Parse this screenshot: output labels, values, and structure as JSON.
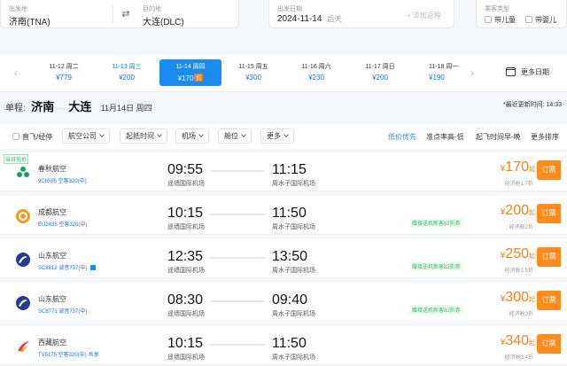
{
  "search": {
    "from_label": "出发地",
    "from_value": "济南(TNA)",
    "to_label": "目的地",
    "to_value": "大连(DLC)",
    "date_label": "出发日期",
    "date_value": "2024-11-14",
    "date_week": "后天",
    "add_return": "+ 添加返程",
    "pax_label": "乘客类型",
    "child": "带儿童",
    "infant": "带婴儿"
  },
  "date_strip": {
    "more": "更多日期",
    "low_tag": "低",
    "days": [
      {
        "date": "11-12 周二",
        "price": "¥779"
      },
      {
        "date": "11-13 周三",
        "price": "¥200"
      },
      {
        "date": "11-14 周四",
        "price": "¥170"
      },
      {
        "date": "11-15 周五",
        "price": "¥300"
      },
      {
        "date": "11-16 周六",
        "price": "¥230"
      },
      {
        "date": "11-17 周日",
        "price": "¥200"
      },
      {
        "date": "11-18 周一",
        "price": "¥190"
      }
    ]
  },
  "route": {
    "label": "单程:",
    "from": "济南",
    "to": "大连",
    "date": "11月14日 周四",
    "updated": "*最近更新时间: 14:33"
  },
  "filters": {
    "direct": "直飞/经停",
    "buttons": [
      "航空公司",
      "起抵时间",
      "机场",
      "舱位",
      "更多"
    ],
    "sorts": [
      "低价优先",
      "准点率高-低",
      "起飞时间早-晚",
      "更多排序"
    ]
  },
  "lowest_tag": "当日低价",
  "flights": [
    {
      "airline": "春秋航空",
      "no": "9C6595 空客320(中)",
      "dep_time": "09:55",
      "dep_airport": "遥墙国际机场",
      "arr_time": "11:15",
      "arr_airport": "周水子国际机场",
      "promo": "",
      "price": "170",
      "discount": "经济舱1.7折",
      "book": "订票",
      "color": "#19a05a"
    },
    {
      "airline": "成都航空",
      "no": "EU2435 空客320(中)",
      "dep_time": "10:15",
      "dep_airport": "遥墙国际机场",
      "arr_time": "11:50",
      "arr_airport": "周水子国际机场",
      "promo": "赠接送机新客82折券",
      "price": "200",
      "discount": "经济舱2折",
      "book": "订票",
      "color": "#f29b1c"
    },
    {
      "airline": "山东航空",
      "no": "SC8812 波音737(中)",
      "dep_time": "12:35",
      "dep_airport": "遥墙国际机场",
      "arr_time": "13:50",
      "arr_airport": "周水子国际机场",
      "promo": "赠接送机新客82折券",
      "price": "250",
      "discount": "经济舱2.5折",
      "book": "订票",
      "color": "#2a3a8c"
    },
    {
      "airline": "山东航空",
      "no": "SC8771 波音737(中)",
      "dep_time": "08:30",
      "dep_airport": "遥墙国际机场",
      "arr_time": "09:40",
      "arr_airport": "周水子国际机场",
      "promo": "赠接送机新客82折券",
      "price": "300",
      "discount": "经济舱3折",
      "book": "订票",
      "color": "#2a3a8c"
    },
    {
      "airline": "西藏航空",
      "no": "TV5175 空客320(中)",
      "share": "共享",
      "dep_time": "10:15",
      "dep_airport": "遥墙国际机场",
      "arr_time": "11:50",
      "arr_airport": "周水子国际机场",
      "promo": "",
      "price": "340",
      "discount": "经济舱3.4折",
      "book": "订票",
      "color": "#e23a3a"
    }
  ],
  "price_currency": "¥",
  "price_suffix": "起"
}
